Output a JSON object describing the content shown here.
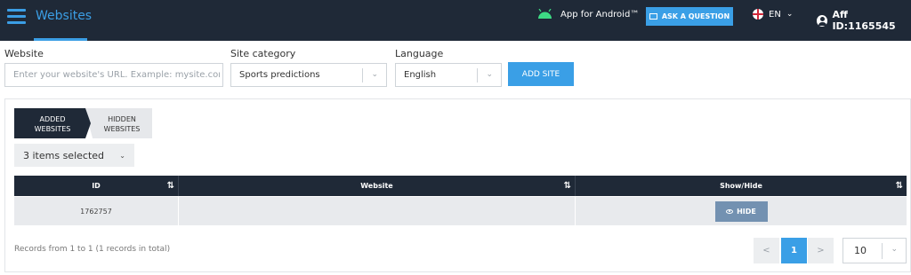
{
  "header": {
    "title": "Websites",
    "android_label": "App for Android™",
    "ask_label": "ASK A QUESTION",
    "lang_code": "EN",
    "aff_id": "Aff ID:1165545"
  },
  "form": {
    "website_label": "Website",
    "website_placeholder": "Enter your website's URL. Example: mysite.com",
    "category_label": "Site category",
    "category_value": "Sports predictions",
    "language_label": "Language",
    "language_value": "English",
    "add_label": "ADD SITE"
  },
  "tabs": {
    "added_line1": "ADDED",
    "added_line2": "WEBSITES",
    "hidden_line1": "HIDDEN",
    "hidden_line2": "WEBSITES"
  },
  "filter": {
    "selected": "3 items selected"
  },
  "table": {
    "columns": [
      "ID",
      "Website",
      "Show/Hide"
    ],
    "rows": [
      {
        "id": "1762757",
        "website": "",
        "action": "HIDE"
      }
    ]
  },
  "footer": {
    "records": "Records from 1 to 1 (1 records in total)",
    "prev": "<",
    "page": "1",
    "next": ">",
    "per_page": "10"
  },
  "colors": {
    "topbar": "#1f2937",
    "accent": "#3a9fe6",
    "hide_button": "#7391b1"
  }
}
